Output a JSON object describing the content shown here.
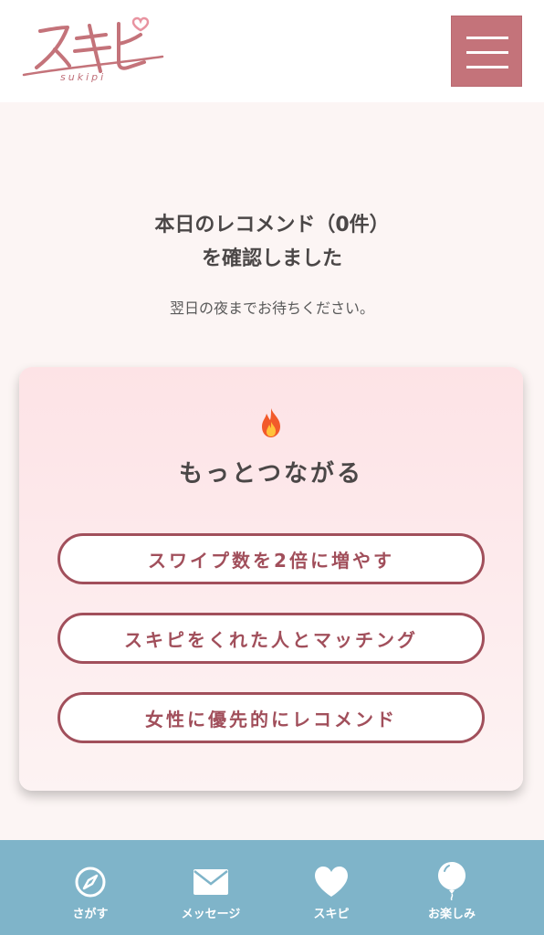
{
  "header": {
    "logo_text": "スキピ",
    "logo_sub": "sukipi",
    "menu_icon": "hamburger-menu-icon"
  },
  "main": {
    "title_line1": "本日のレコメンド（0件）",
    "title_line2": "を確認しました",
    "subtitle": "翌日の夜までお待ちください。"
  },
  "card": {
    "icon": "fire-icon",
    "heading": "もっとつながる",
    "buttons": [
      {
        "label": "スワイプ数を2倍に増やす"
      },
      {
        "label": "スキピをくれた人とマッチング"
      },
      {
        "label": "女性に優先的にレコメンド"
      }
    ]
  },
  "nav": {
    "items": [
      {
        "label": "さがす",
        "icon": "compass-icon"
      },
      {
        "label": "メッセージ",
        "icon": "envelope-icon"
      },
      {
        "label": "スキピ",
        "icon": "heart-icon"
      },
      {
        "label": "お楽しみ",
        "icon": "balloon-icon"
      }
    ]
  },
  "colors": {
    "accent": "#c4737a",
    "button_border": "#a14f5b",
    "nav_background": "#7fb4c9",
    "page_background": "#fcf5f4"
  }
}
